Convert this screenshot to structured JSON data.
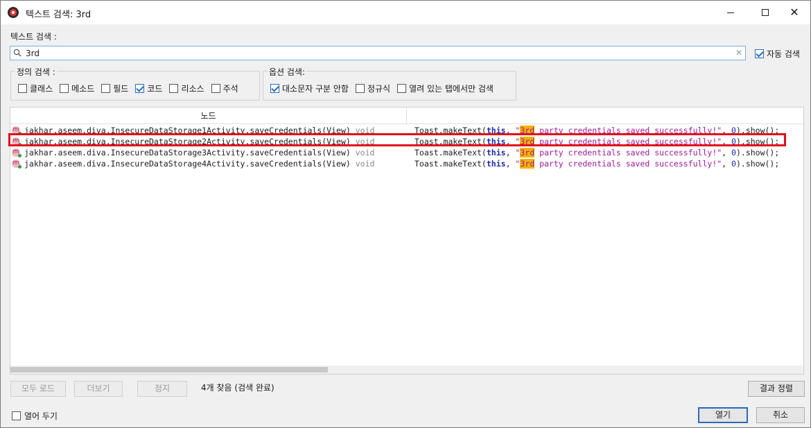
{
  "window": {
    "title": "텍스트 검색: 3rd"
  },
  "search": {
    "label": "텍스트 검색 :",
    "value": "3rd",
    "clear_icon": "clear-icon",
    "auto_search_label": "자동 검색",
    "auto_search_checked": true
  },
  "definition_search": {
    "title": "정의 검색 :",
    "options": [
      {
        "label": "클래스",
        "checked": false
      },
      {
        "label": "메소드",
        "checked": false
      },
      {
        "label": "필드",
        "checked": false
      },
      {
        "label": "코드",
        "checked": true
      },
      {
        "label": "리소스",
        "checked": false
      },
      {
        "label": "주석",
        "checked": false
      }
    ]
  },
  "option_search": {
    "title": "옵션 검색:",
    "options": [
      {
        "label": "대소문자 구분 안함",
        "checked": true
      },
      {
        "label": "정규식",
        "checked": false
      },
      {
        "label": "열려 있는 탭에서만 검색",
        "checked": false
      }
    ]
  },
  "results": {
    "column_node": "노드",
    "rows": [
      {
        "node": "jakhar.aseem.diva.InsecureDataStorage1Activity.saveCredentials(View)",
        "return_type": "void",
        "code": {
          "pre": "Toast.makeText(",
          "kw": "this",
          "sep": ", ",
          "q1": "\"",
          "match": "3rd",
          "rest": " party credentials saved successfully!\"",
          "sep2": ", ",
          "num": "0",
          "tail": ").show();"
        },
        "highlighted": false
      },
      {
        "node": "jakhar.aseem.diva.InsecureDataStorage2Activity.saveCredentials(View)",
        "return_type": "void",
        "code": {
          "pre": "Toast.makeText(",
          "kw": "this",
          "sep": ", ",
          "q1": "\"",
          "match": "3rd",
          "rest": " party credentials saved successfully!\"",
          "sep2": ", ",
          "num": "0",
          "tail": ").show();"
        },
        "highlighted": true
      },
      {
        "node": "jakhar.aseem.diva.InsecureDataStorage3Activity.saveCredentials(View)",
        "return_type": "void",
        "code": {
          "pre": "Toast.makeText(",
          "kw": "this",
          "sep": ", ",
          "q1": "\"",
          "match": "3rd",
          "rest": " party credentials saved successfully!\"",
          "sep2": ", ",
          "num": "0",
          "tail": ").show();"
        },
        "highlighted": false
      },
      {
        "node": "jakhar.aseem.diva.InsecureDataStorage4Activity.saveCredentials(View)",
        "return_type": "void",
        "code": {
          "pre": "Toast.makeText(",
          "kw": "this",
          "sep": ", ",
          "q1": "\"",
          "match": "3rd",
          "rest": " party credentials saved successfully!\"",
          "sep2": ", ",
          "num": "0",
          "tail": ").show();"
        },
        "highlighted": false
      }
    ]
  },
  "footer": {
    "load_all_label": "모두 로드",
    "more_label": "더보기",
    "stop_label": "정지",
    "status": "4개 찾음 (검색 완료)",
    "sort_label": "결과 정렬",
    "keep_open_label": "열어 두기",
    "keep_open_checked": false,
    "open_label": "열기",
    "cancel_label": "취소"
  },
  "icons": {
    "app": "jadx-app-icon",
    "method": "method-icon",
    "search": "search-icon"
  },
  "colors": {
    "match_highlight": "#f5b000",
    "selection_outline": "#e0101a",
    "keyword": "#1a2aa8",
    "string": "#a0189a"
  }
}
